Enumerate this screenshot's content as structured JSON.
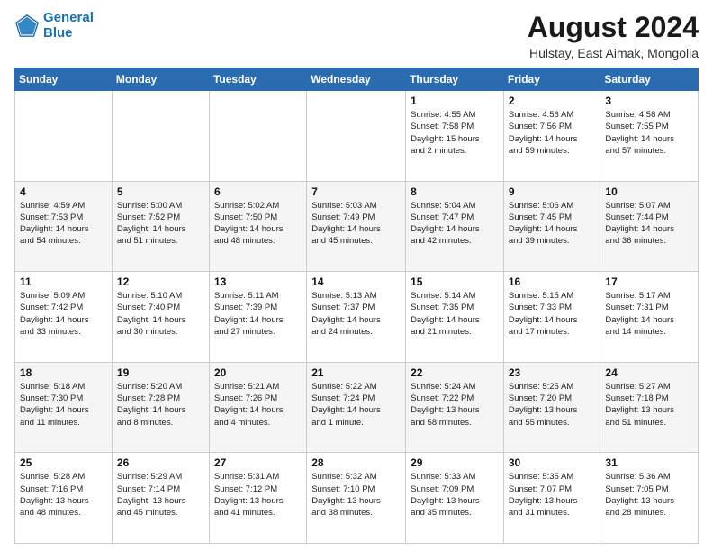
{
  "logo": {
    "line1": "General",
    "line2": "Blue"
  },
  "title": "August 2024",
  "subtitle": "Hulstay, East Aimak, Mongolia",
  "days_header": [
    "Sunday",
    "Monday",
    "Tuesday",
    "Wednesday",
    "Thursday",
    "Friday",
    "Saturday"
  ],
  "weeks": [
    [
      {
        "num": "",
        "info": ""
      },
      {
        "num": "",
        "info": ""
      },
      {
        "num": "",
        "info": ""
      },
      {
        "num": "",
        "info": ""
      },
      {
        "num": "1",
        "info": "Sunrise: 4:55 AM\nSunset: 7:58 PM\nDaylight: 15 hours\nand 2 minutes."
      },
      {
        "num": "2",
        "info": "Sunrise: 4:56 AM\nSunset: 7:56 PM\nDaylight: 14 hours\nand 59 minutes."
      },
      {
        "num": "3",
        "info": "Sunrise: 4:58 AM\nSunset: 7:55 PM\nDaylight: 14 hours\nand 57 minutes."
      }
    ],
    [
      {
        "num": "4",
        "info": "Sunrise: 4:59 AM\nSunset: 7:53 PM\nDaylight: 14 hours\nand 54 minutes."
      },
      {
        "num": "5",
        "info": "Sunrise: 5:00 AM\nSunset: 7:52 PM\nDaylight: 14 hours\nand 51 minutes."
      },
      {
        "num": "6",
        "info": "Sunrise: 5:02 AM\nSunset: 7:50 PM\nDaylight: 14 hours\nand 48 minutes."
      },
      {
        "num": "7",
        "info": "Sunrise: 5:03 AM\nSunset: 7:49 PM\nDaylight: 14 hours\nand 45 minutes."
      },
      {
        "num": "8",
        "info": "Sunrise: 5:04 AM\nSunset: 7:47 PM\nDaylight: 14 hours\nand 42 minutes."
      },
      {
        "num": "9",
        "info": "Sunrise: 5:06 AM\nSunset: 7:45 PM\nDaylight: 14 hours\nand 39 minutes."
      },
      {
        "num": "10",
        "info": "Sunrise: 5:07 AM\nSunset: 7:44 PM\nDaylight: 14 hours\nand 36 minutes."
      }
    ],
    [
      {
        "num": "11",
        "info": "Sunrise: 5:09 AM\nSunset: 7:42 PM\nDaylight: 14 hours\nand 33 minutes."
      },
      {
        "num": "12",
        "info": "Sunrise: 5:10 AM\nSunset: 7:40 PM\nDaylight: 14 hours\nand 30 minutes."
      },
      {
        "num": "13",
        "info": "Sunrise: 5:11 AM\nSunset: 7:39 PM\nDaylight: 14 hours\nand 27 minutes."
      },
      {
        "num": "14",
        "info": "Sunrise: 5:13 AM\nSunset: 7:37 PM\nDaylight: 14 hours\nand 24 minutes."
      },
      {
        "num": "15",
        "info": "Sunrise: 5:14 AM\nSunset: 7:35 PM\nDaylight: 14 hours\nand 21 minutes."
      },
      {
        "num": "16",
        "info": "Sunrise: 5:15 AM\nSunset: 7:33 PM\nDaylight: 14 hours\nand 17 minutes."
      },
      {
        "num": "17",
        "info": "Sunrise: 5:17 AM\nSunset: 7:31 PM\nDaylight: 14 hours\nand 14 minutes."
      }
    ],
    [
      {
        "num": "18",
        "info": "Sunrise: 5:18 AM\nSunset: 7:30 PM\nDaylight: 14 hours\nand 11 minutes."
      },
      {
        "num": "19",
        "info": "Sunrise: 5:20 AM\nSunset: 7:28 PM\nDaylight: 14 hours\nand 8 minutes."
      },
      {
        "num": "20",
        "info": "Sunrise: 5:21 AM\nSunset: 7:26 PM\nDaylight: 14 hours\nand 4 minutes."
      },
      {
        "num": "21",
        "info": "Sunrise: 5:22 AM\nSunset: 7:24 PM\nDaylight: 14 hours\nand 1 minute."
      },
      {
        "num": "22",
        "info": "Sunrise: 5:24 AM\nSunset: 7:22 PM\nDaylight: 13 hours\nand 58 minutes."
      },
      {
        "num": "23",
        "info": "Sunrise: 5:25 AM\nSunset: 7:20 PM\nDaylight: 13 hours\nand 55 minutes."
      },
      {
        "num": "24",
        "info": "Sunrise: 5:27 AM\nSunset: 7:18 PM\nDaylight: 13 hours\nand 51 minutes."
      }
    ],
    [
      {
        "num": "25",
        "info": "Sunrise: 5:28 AM\nSunset: 7:16 PM\nDaylight: 13 hours\nand 48 minutes."
      },
      {
        "num": "26",
        "info": "Sunrise: 5:29 AM\nSunset: 7:14 PM\nDaylight: 13 hours\nand 45 minutes."
      },
      {
        "num": "27",
        "info": "Sunrise: 5:31 AM\nSunset: 7:12 PM\nDaylight: 13 hours\nand 41 minutes."
      },
      {
        "num": "28",
        "info": "Sunrise: 5:32 AM\nSunset: 7:10 PM\nDaylight: 13 hours\nand 38 minutes."
      },
      {
        "num": "29",
        "info": "Sunrise: 5:33 AM\nSunset: 7:09 PM\nDaylight: 13 hours\nand 35 minutes."
      },
      {
        "num": "30",
        "info": "Sunrise: 5:35 AM\nSunset: 7:07 PM\nDaylight: 13 hours\nand 31 minutes."
      },
      {
        "num": "31",
        "info": "Sunrise: 5:36 AM\nSunset: 7:05 PM\nDaylight: 13 hours\nand 28 minutes."
      }
    ]
  ]
}
